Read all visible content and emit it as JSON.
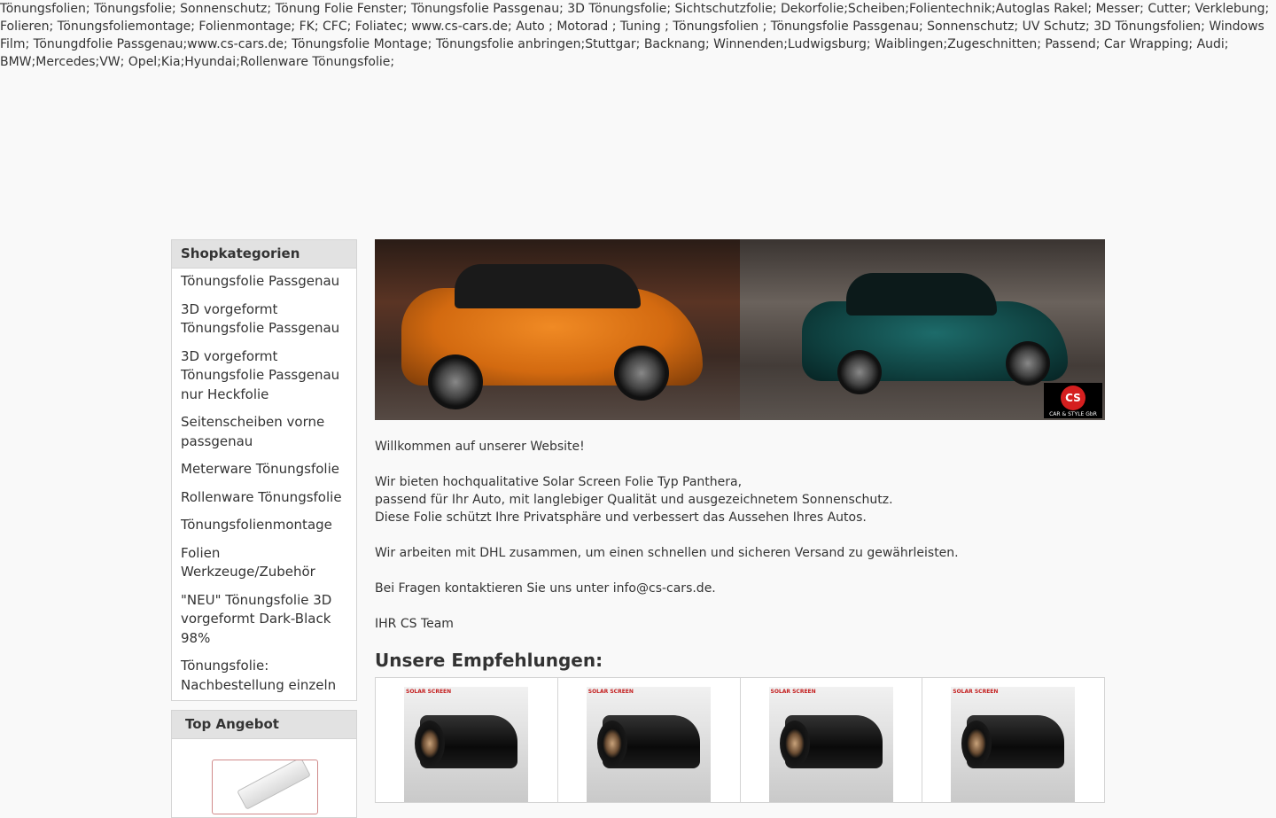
{
  "keywords": "Tönungsfolien; Tönungsfolie; Sonnenschutz; Tönung Folie Fenster; Tönungsfolie Passgenau; 3D Tönungsfolie; Sichtschutzfolie; Dekorfolie;Scheiben;Folientechnik;Autoglas Rakel; Messer; Cutter; Verklebung; Folieren; Tönungsfoliemontage; Folienmontage; FK; CFC; Foliatec; www.cs-cars.de; Auto ; Motorad ; Tuning ; Tönungsfolien ; Tönungsfolie Passgenau; Sonnenschutz; UV Schutz; 3D Tönungsfolien; Windows Film; Tönungdfolie Passgenau;www.cs-cars.de; Tönungsfolie Montage; Tönungsfolie anbringen;Stuttgar; Backnang; Winnenden;Ludwigsburg; Waiblingen;Zugeschnitten; Passend; Car Wrapping; Audi; BMW;Mercedes;VW; Opel;Kia;Hyundai;Rollenware Tönungsfolie;",
  "sidebar": {
    "categories_title": "Shopkategorien",
    "categories": [
      "Tönungsfolie Passgenau",
      "3D vorgeformt Tönungsfolie Passgenau",
      "3D vorgeformt Tönungsfolie Passgenau nur Heckfolie",
      "Seitenscheiben vorne passgenau",
      "Meterware Tönungsfolie",
      "Rollenware Tönungsfolie",
      "Tönungsfolienmontage",
      "Folien Werkzeuge/Zubehör",
      "\"NEU\" Tönungsfolie 3D vorgeformt Dark-Black 98%",
      "Tönungsfolie: Nachbestellung einzeln"
    ],
    "top_offer_title": "Top Angebot"
  },
  "banner": {
    "logo_text": "CS",
    "logo_subtext": "CAR & STYLE GbR"
  },
  "welcome": {
    "greeting": "Willkommen auf unserer Website!",
    "line1": "Wir bieten hochqualitative Solar Screen Folie Typ Panthera,",
    "line2": "passend für Ihr Auto, mit langlebiger Qualität und ausgezeichnetem Sonnenschutz.",
    "line3": "Diese Folie schützt Ihre Privatsphäre und verbessert das Aussehen Ihres Autos.",
    "shipping": "Wir arbeiten mit DHL zusammen, um einen schnellen und sicheren Versand zu gewährleisten.",
    "contact": "Bei Fragen kontaktieren Sie uns unter info@cs-cars.de.",
    "signature": "IHR CS Team"
  },
  "recommendations": {
    "title": "Unsere Empfehlungen:",
    "brand_label": "SOLAR SCREEN",
    "product_count": 4
  }
}
